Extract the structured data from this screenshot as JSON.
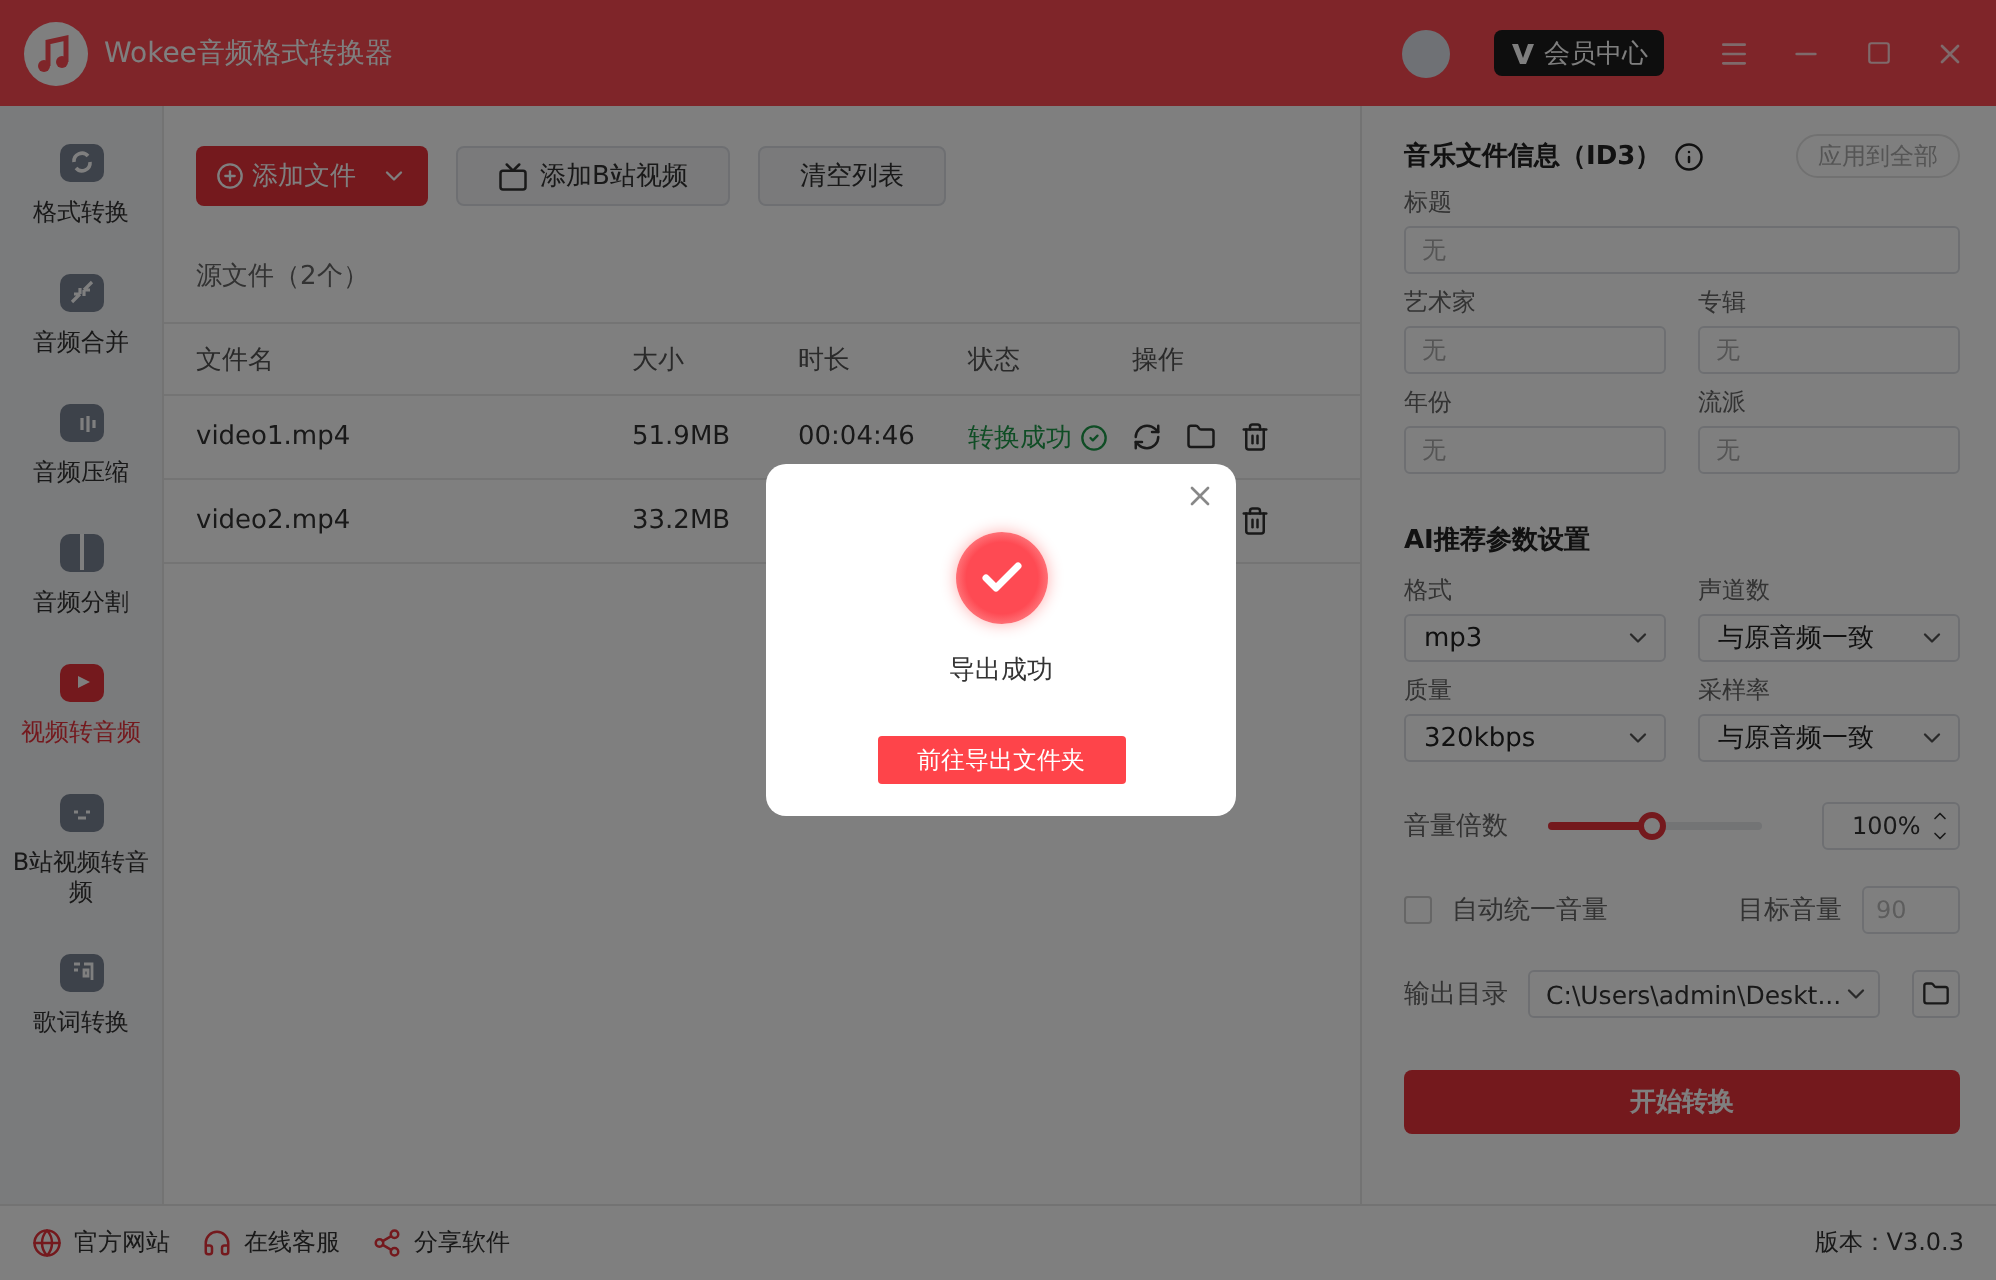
{
  "window": {
    "title": "Wokee音频格式转换器",
    "vip_label": "会员中心"
  },
  "sidebar": {
    "items": [
      {
        "label": "格式转换",
        "kind": "convert",
        "selected": false
      },
      {
        "label": "音频合并",
        "kind": "merge",
        "selected": false
      },
      {
        "label": "音频压缩",
        "kind": "compress",
        "selected": false
      },
      {
        "label": "音频分割",
        "kind": "split",
        "selected": false
      },
      {
        "label": "视频转音频",
        "kind": "video",
        "selected": true
      },
      {
        "label": "B站视频转音频",
        "kind": "tv",
        "selected": false
      },
      {
        "label": "歌词转换",
        "kind": "lyrics",
        "selected": false
      }
    ]
  },
  "toolbar": {
    "add_file": "添加文件",
    "add_bilibili": "添加B站视频",
    "clear": "清空列表"
  },
  "file_list": {
    "title": "源文件（2个）",
    "columns": [
      "文件名",
      "大小",
      "时长",
      "状态",
      "操作"
    ],
    "rows": [
      {
        "name": "video1.mp4",
        "size": "51.9MB",
        "duration": "00:04:46",
        "status": "转换成功"
      },
      {
        "name": "video2.mp4",
        "size": "33.2MB"
      }
    ]
  },
  "id3": {
    "title": "音乐文件信息（ID3）",
    "apply_all": "应用到全部",
    "fields": [
      {
        "label": "标题",
        "placeholder": "无"
      },
      {
        "label": "艺术家",
        "placeholder": "无"
      },
      {
        "label": "专辑",
        "placeholder": "无"
      },
      {
        "label": "年份",
        "placeholder": "无"
      },
      {
        "label": "流派",
        "placeholder": "无"
      }
    ]
  },
  "params": {
    "title": "AI推荐参数设置",
    "selects": [
      {
        "label": "格式",
        "value": "mp3"
      },
      {
        "label": "声道数",
        "value": "与原音频一致"
      },
      {
        "label": "质量",
        "value": "320kbps"
      },
      {
        "label": "采样率",
        "value": "与原音频一致"
      }
    ]
  },
  "volume": {
    "label": "音量倍数",
    "level": 0.49,
    "value": "100%"
  },
  "auto_volume": {
    "label": "自动统一音量",
    "checked": false,
    "target_label": "目标音量",
    "target_placeholder": "90"
  },
  "output": {
    "label": "输出目录",
    "value": "C:\\Users\\admin\\Deskt..."
  },
  "start_button": "开始转换",
  "footer": {
    "links": [
      {
        "label": "官方网站",
        "kind": "globe"
      },
      {
        "label": "在线客服",
        "kind": "headset"
      },
      {
        "label": "分享软件",
        "kind": "share"
      }
    ],
    "version": "版本：V3.0.3"
  },
  "dialog": {
    "message": "导出成功",
    "button": "前往导出文件夹"
  }
}
